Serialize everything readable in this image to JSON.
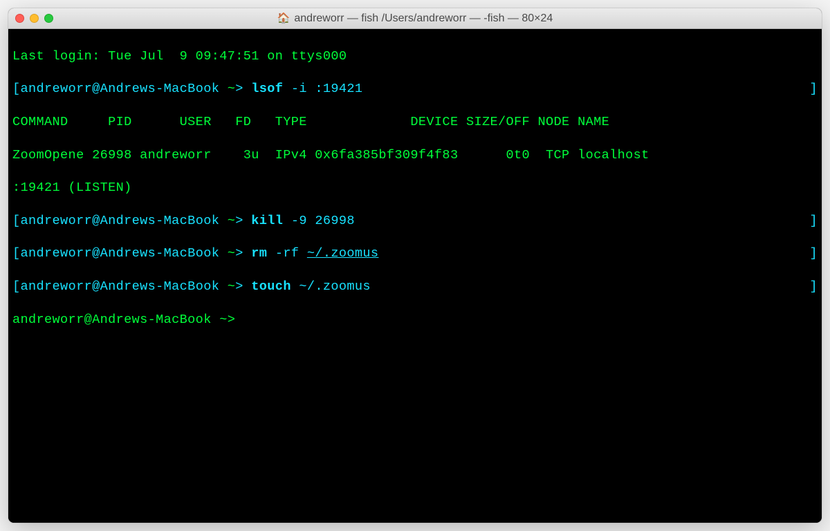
{
  "titlebar": {
    "title": "andreworr — fish  /Users/andreworr — -fish — 80×24"
  },
  "colors": {
    "green": "#00ff3a",
    "cyan": "#18e1ff"
  },
  "terminal": {
    "last_login": "Last login: Tue Jul  9 09:47:51 on ttys000",
    "prompt_host": "andreworr@Andrews-MacBook",
    "prompt_path": " ~",
    "prompt_sep": ">",
    "lbracket": "[",
    "rbracket": "]",
    "commands": {
      "lsof": {
        "cmd": "lsof",
        "args": " -i :19421"
      },
      "kill": {
        "cmd": "kill",
        "args": " -9 26998"
      },
      "rm": {
        "cmd": "rm",
        "args_pre": " -rf ",
        "arg_ul": "~/.zoomus"
      },
      "touch": {
        "cmd": "touch",
        "args_pre": " ",
        "arg_plain": "~/.zoomus"
      }
    },
    "lsof_output": {
      "header": "COMMAND     PID      USER   FD   TYPE             DEVICE SIZE/OFF NODE NAME",
      "row": "ZoomOpene 26998 andreworr    3u  IPv4 0x6fa385bf309f4f83      0t0  TCP localhost",
      "row2": ":19421 (LISTEN)"
    }
  }
}
